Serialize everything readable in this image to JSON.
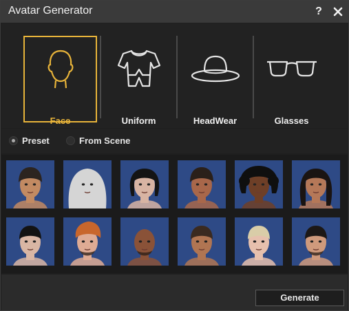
{
  "window": {
    "title": "Avatar Generator",
    "help_label": "?",
    "close_label": "✕"
  },
  "tabs": [
    {
      "label": "Face",
      "icon": "face-icon",
      "selected": true
    },
    {
      "label": "Uniform",
      "icon": "shirt-icon",
      "selected": false
    },
    {
      "label": "HeadWear",
      "icon": "hat-icon",
      "selected": false
    },
    {
      "label": "Glasses",
      "icon": "glasses-icon",
      "selected": false
    }
  ],
  "source_options": [
    {
      "label": "Preset",
      "selected": true
    },
    {
      "label": "From Scene",
      "selected": false
    }
  ],
  "gallery": {
    "avatars": [
      {
        "skin": "#c28a62",
        "hair": "#2b2420",
        "style": "bun",
        "beard": false
      },
      {
        "skin": "#d7a388",
        "hair": "#d5d5d5",
        "style": "hijab",
        "beard": false
      },
      {
        "skin": "#d8b4a3",
        "hair": "#141414",
        "style": "bob",
        "beard": false
      },
      {
        "skin": "#a8674a",
        "hair": "#2a201a",
        "style": "bun",
        "beard": false
      },
      {
        "skin": "#6e3f27",
        "hair": "#0f0f0f",
        "style": "curly",
        "beard": false
      },
      {
        "skin": "#b57858",
        "hair": "#1a1412",
        "style": "long",
        "beard": false
      },
      {
        "skin": "#d9b6a4",
        "hair": "#131313",
        "style": "short",
        "beard": false
      },
      {
        "skin": "#deab94",
        "hair": "#c8662c",
        "style": "spiky",
        "beard": true
      },
      {
        "skin": "#8a5238",
        "hair": "#8a5238",
        "style": "bald",
        "beard": true
      },
      {
        "skin": "#b07552",
        "hair": "#3a2a20",
        "style": "short",
        "beard": false
      },
      {
        "skin": "#e6c0ad",
        "hair": "#d9cda8",
        "style": "short",
        "beard": false
      },
      {
        "skin": "#cf9a7c",
        "hair": "#1c1816",
        "style": "short",
        "beard": true
      }
    ]
  },
  "footer": {
    "generate_label": "Generate"
  },
  "colors": {
    "accent": "#e8b43a",
    "thumb_bg": "#2e4a86"
  }
}
